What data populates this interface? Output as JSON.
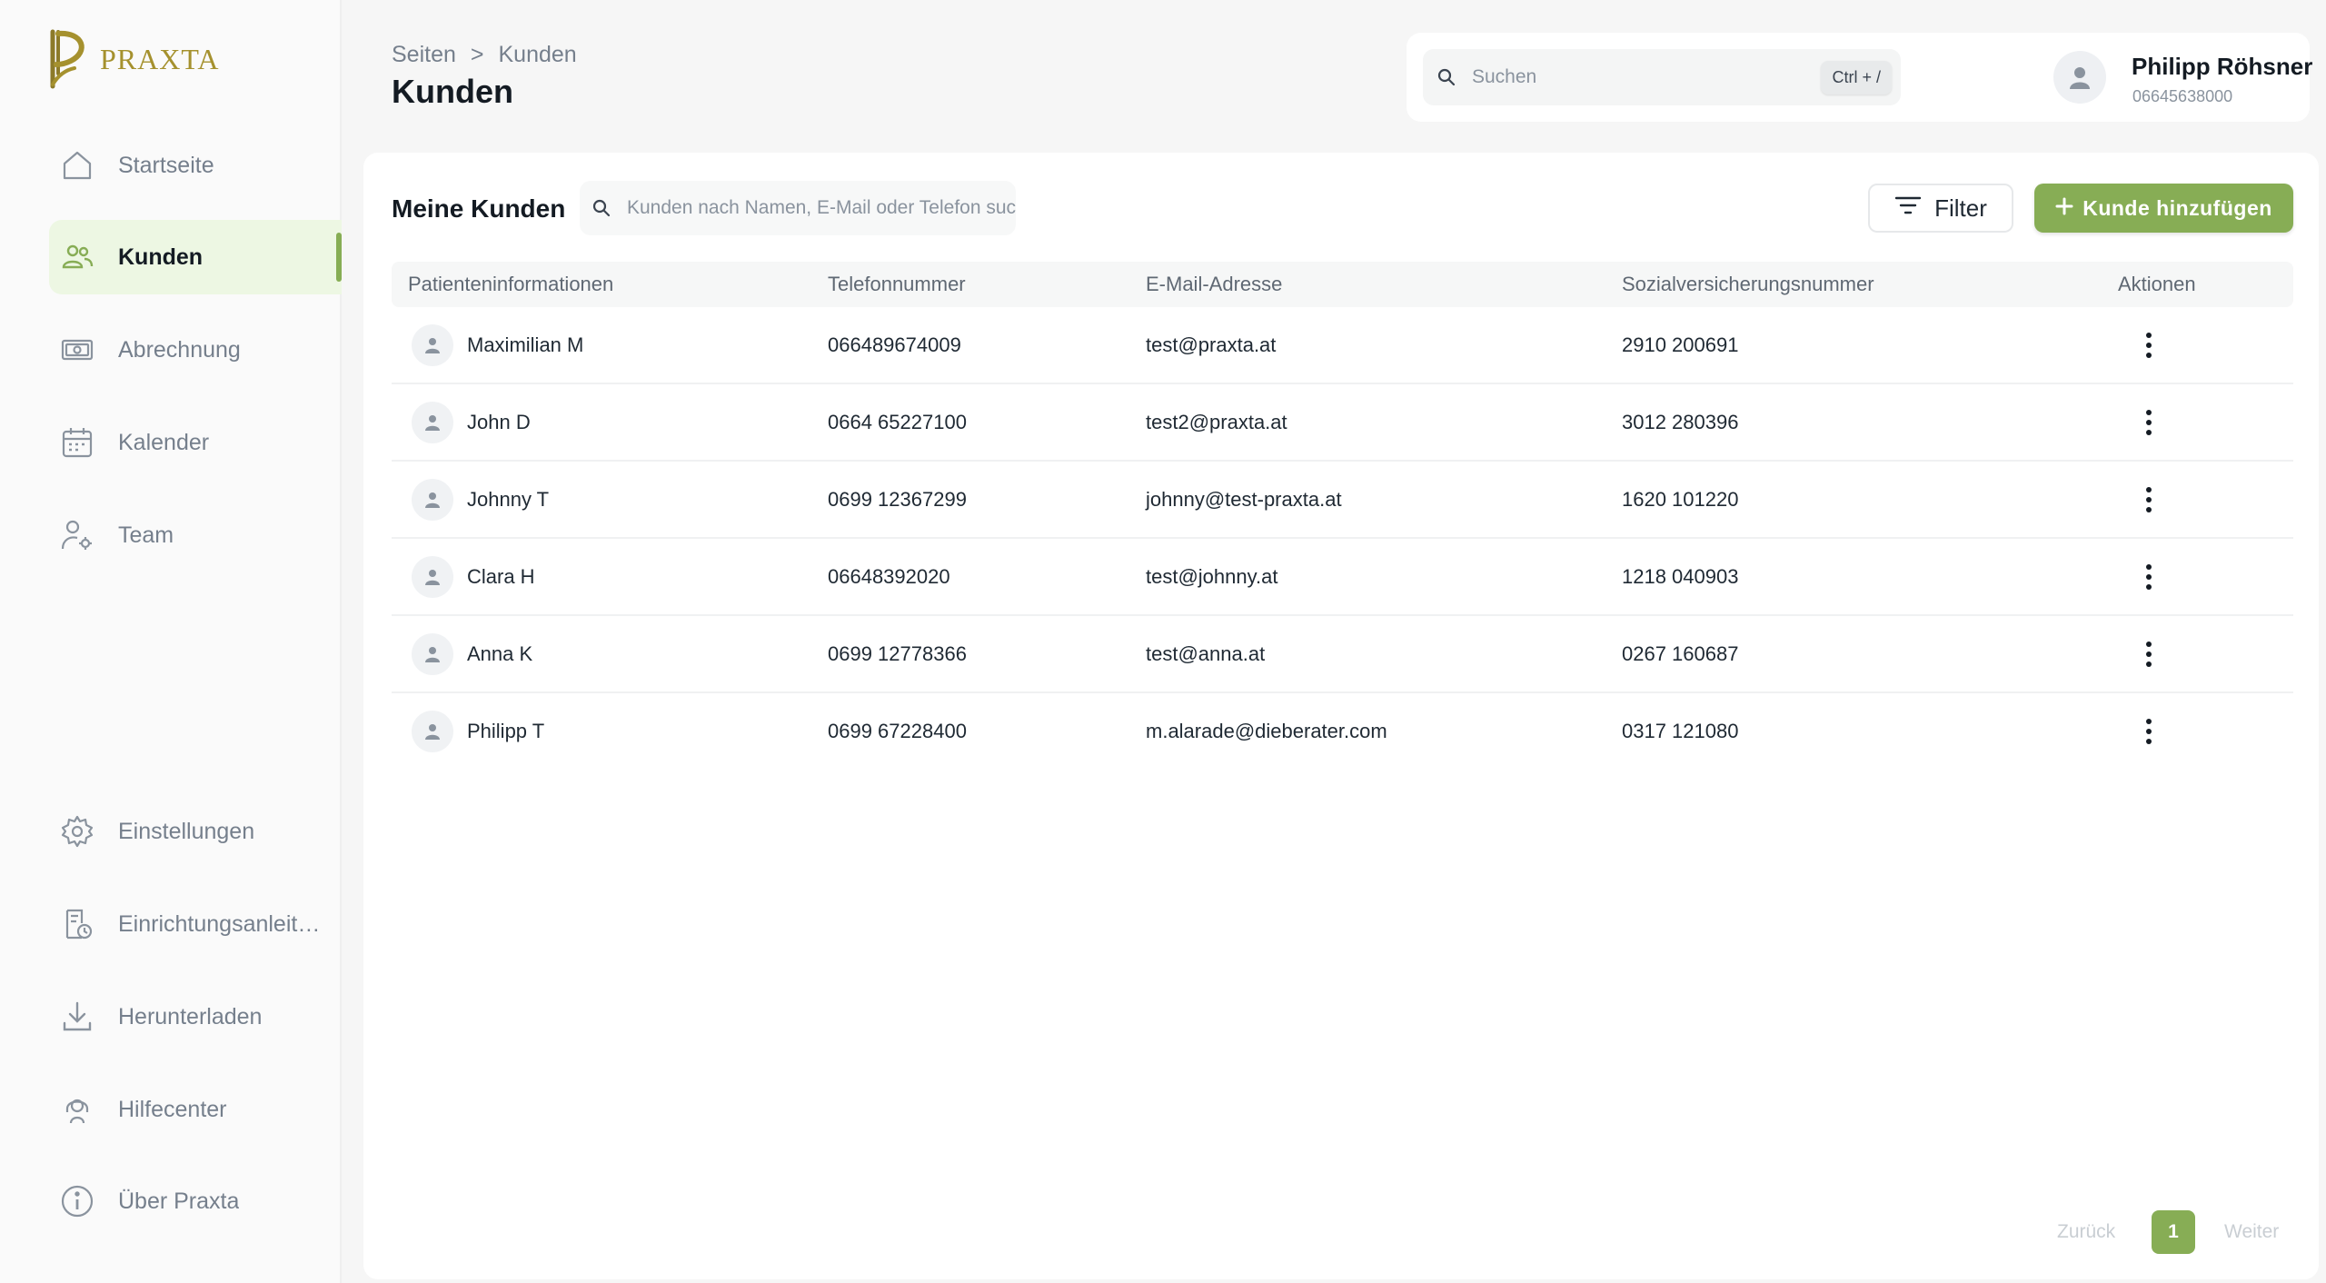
{
  "brand": {
    "name": "PRAXTA",
    "accent": "#87ad55",
    "gold": "#a5912e"
  },
  "sidebar": {
    "items": [
      {
        "label": "Startseite",
        "icon": "home-icon"
      },
      {
        "label": "Kunden",
        "icon": "users-icon",
        "active": true
      },
      {
        "label": "Abrechnung",
        "icon": "billing-icon"
      },
      {
        "label": "Kalender",
        "icon": "calendar-icon"
      },
      {
        "label": "Team",
        "icon": "team-icon"
      }
    ],
    "bottom_items": [
      {
        "label": "Einstellungen",
        "icon": "gear-icon"
      },
      {
        "label": "Einrichtungsanleitung",
        "icon": "setup-guide-icon"
      },
      {
        "label": "Herunterladen",
        "icon": "download-icon"
      },
      {
        "label": "Hilfecenter",
        "icon": "help-icon"
      },
      {
        "label": "Über Praxta",
        "icon": "info-icon"
      }
    ]
  },
  "header": {
    "breadcrumb": {
      "root": "Seiten",
      "separator": ">",
      "current": "Kunden"
    },
    "title": "Kunden",
    "search": {
      "placeholder": "Suchen",
      "shortcut": "Ctrl + /"
    },
    "user": {
      "name": "Philipp Röhsner",
      "phone": "06645638000"
    }
  },
  "main": {
    "title": "Meine Kunden",
    "search_placeholder": "Kunden nach Namen, E-Mail oder Telefon suchen",
    "filter_label": "Filter",
    "add_label": "Kunde hinzufügen",
    "columns": [
      "Patienteninformationen",
      "Telefonnummer",
      "E-Mail-Adresse",
      "Sozialversicherungsnummer",
      "Aktionen"
    ],
    "rows": [
      {
        "name": "Maximilian M",
        "phone": "066489674009",
        "email": "test@praxta.at",
        "svn": "2910 200691"
      },
      {
        "name": "John D",
        "phone": "0664 65227100",
        "email": "test2@praxta.at",
        "svn": "3012 280396"
      },
      {
        "name": "Johnny T",
        "phone": "0699 12367299",
        "email": "johnny@test-praxta.at",
        "svn": "1620 101220"
      },
      {
        "name": "Clara H",
        "phone": "06648392020",
        "email": "test@johnny.at",
        "svn": "1218 040903"
      },
      {
        "name": "Anna K",
        "phone": "0699 12778366",
        "email": "test@anna.at",
        "svn": "0267 160687"
      },
      {
        "name": "Philipp T",
        "phone": "0699 67228400",
        "email": "m.alarade@dieberater.com",
        "svn": "0317 121080"
      }
    ],
    "pagination": {
      "prev": "Zurück",
      "page": "1",
      "next": "Weiter"
    }
  }
}
